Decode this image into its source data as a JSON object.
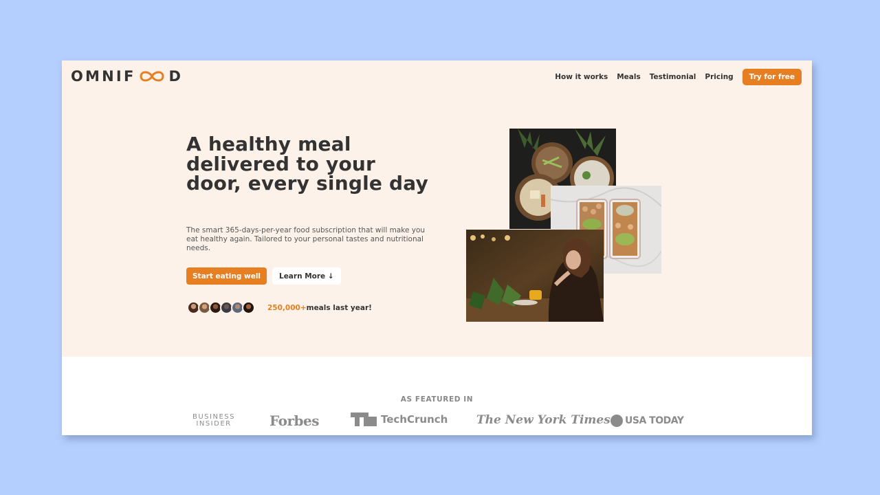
{
  "header": {
    "logo_left": "OMNIF",
    "logo_right": "D",
    "logo_icon": "infinity-icon",
    "nav": {
      "how_it_works": "How it works",
      "meals": "Meals",
      "testimonial": "Testimonial",
      "pricing": "Pricing",
      "cta": "Try for free"
    }
  },
  "hero": {
    "title": "A healthy meal delivered to your door, every single day",
    "description": "The smart 365-days-per-year food subscription that will make you eat healthy again. Tailored to your personal tastes and nutritional needs.",
    "primary_button": "Start eating well",
    "secondary_button": "Learn More ↓",
    "meals_count": "250,000+",
    "meals_suffix": "meals last year!"
  },
  "featured": {
    "title": "AS FEATURED IN",
    "logos": {
      "business_insider_line1": "BUSINESS",
      "business_insider_line2": "INSIDER",
      "forbes": "Forbes",
      "techcrunch": "TechCrunch",
      "nyt": "The New York Times",
      "usa_today": "USA TODAY"
    }
  },
  "colors": {
    "accent": "#e67e22",
    "hero_bg": "#fdf2e9",
    "page_bg": "#b4cffd",
    "text": "#333333"
  }
}
